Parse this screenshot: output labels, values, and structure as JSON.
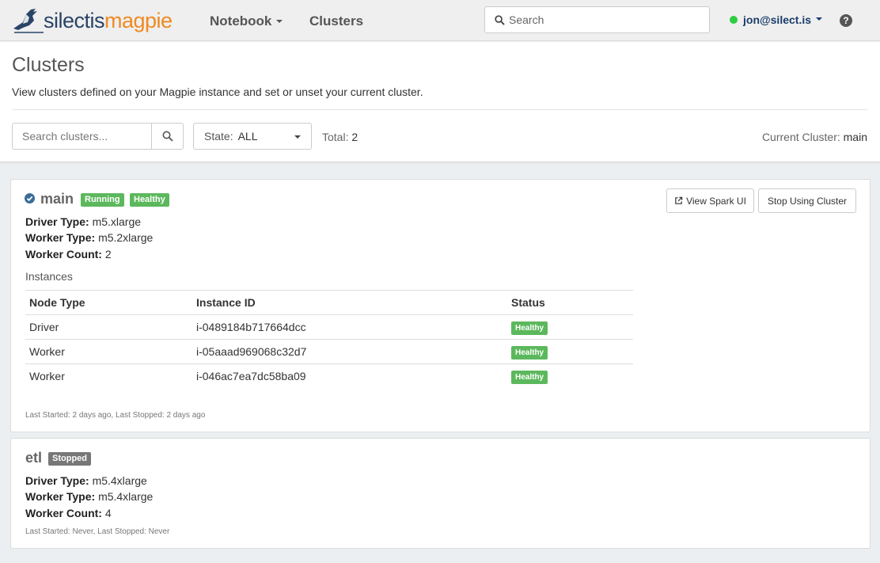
{
  "nav": {
    "brand_a": "silectis",
    "brand_b": "magpie",
    "notebook": "Notebook",
    "clusters": "Clusters",
    "search_placeholder": "Search",
    "user": "jon@silect.is",
    "help": "?"
  },
  "header": {
    "title": "Clusters",
    "description": "View clusters defined on your Magpie instance and set or unset your current cluster.",
    "search_placeholder": "Search clusters...",
    "state_label": "State:",
    "state_value": "ALL",
    "total_label": "Total:",
    "total_value": "2",
    "current_label": "Current Cluster:",
    "current_value": "main"
  },
  "clusters": [
    {
      "name": "main",
      "status": "Running",
      "health": "Healthy",
      "driver_label": "Driver Type:",
      "driver": "m5.xlarge",
      "worker_label": "Worker Type:",
      "worker": "m5.2xlarge",
      "count_label": "Worker Count:",
      "count": "2",
      "view_spark": "View Spark UI",
      "stop_using": "Stop Using Cluster",
      "instances_title": "Instances",
      "columns": [
        "Node Type",
        "Instance ID",
        "Status"
      ],
      "instances": [
        {
          "type": "Driver",
          "id": "i-0489184b717664dcc",
          "status": "Healthy"
        },
        {
          "type": "Worker",
          "id": "i-05aaad969068c32d7",
          "status": "Healthy"
        },
        {
          "type": "Worker",
          "id": "i-046ac7ea7dc58ba09",
          "status": "Healthy"
        }
      ],
      "meta": "Last Started: 2 days ago, Last Stopped: 2 days ago"
    },
    {
      "name": "etl",
      "status": "Stopped",
      "driver_label": "Driver Type:",
      "driver": "m5.4xlarge",
      "worker_label": "Worker Type:",
      "worker": "m5.4xlarge",
      "count_label": "Worker Count:",
      "count": "4",
      "meta": "Last Started: Never, Last Stopped: Never"
    }
  ],
  "colors": {
    "accent_orange": "#ef8a22",
    "brand_navy": "#2a4366",
    "healthy_green": "#5cb85c",
    "stopped_gray": "#777777",
    "online_dot": "#2ecc40"
  }
}
